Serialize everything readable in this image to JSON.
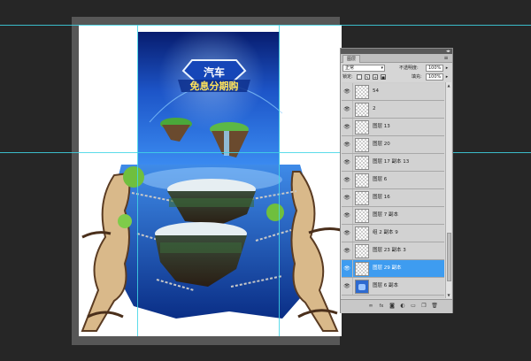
{
  "layers_panel": {
    "tab_label": "图层",
    "menu_icon": "panel-menu-icon",
    "blend_mode": "正常",
    "opacity_label": "不透明度:",
    "opacity_value": "100%",
    "lock_label": "锁定:",
    "fill_label": "填充:",
    "fill_value": "100%",
    "layers": [
      {
        "name": "54",
        "visible": true,
        "thumb": "transparent",
        "selected": false
      },
      {
        "name": "2",
        "visible": true,
        "thumb": "transparent",
        "selected": false
      },
      {
        "name": "图层 13",
        "visible": true,
        "thumb": "transparent",
        "selected": false
      },
      {
        "name": "图层 20",
        "visible": true,
        "thumb": "transparent",
        "selected": false
      },
      {
        "name": "图层 17 副本 13",
        "visible": true,
        "thumb": "transparent",
        "selected": false
      },
      {
        "name": "图层 6",
        "visible": true,
        "thumb": "transparent",
        "selected": false
      },
      {
        "name": "图层 16",
        "visible": true,
        "thumb": "transparent",
        "selected": false
      },
      {
        "name": "图层 7 副本",
        "visible": true,
        "thumb": "transparent",
        "selected": false
      },
      {
        "name": "组 2 副本 9",
        "visible": true,
        "thumb": "transparent",
        "selected": false
      },
      {
        "name": "图层 23 副本 3",
        "visible": true,
        "thumb": "transparent",
        "selected": false
      },
      {
        "name": "图层 29 副本",
        "visible": true,
        "thumb": "transparent",
        "selected": true
      },
      {
        "name": "图层 6 副本",
        "visible": true,
        "thumb": "blue",
        "selected": false
      }
    ],
    "bottom_icons": [
      "link-icon",
      "fx-icon",
      "mask-icon",
      "adjustment-icon",
      "group-icon",
      "new-layer-icon",
      "delete-icon"
    ]
  },
  "artwork": {
    "banner_line1": "汽车",
    "banner_line2": "免息分期购"
  },
  "colors": {
    "workspace": "#262626",
    "selection_blue": "#3e9cf0",
    "guide": "#3fd6e6",
    "sky_top": "#0b2a8a",
    "sky_bottom": "#2f7de0"
  }
}
